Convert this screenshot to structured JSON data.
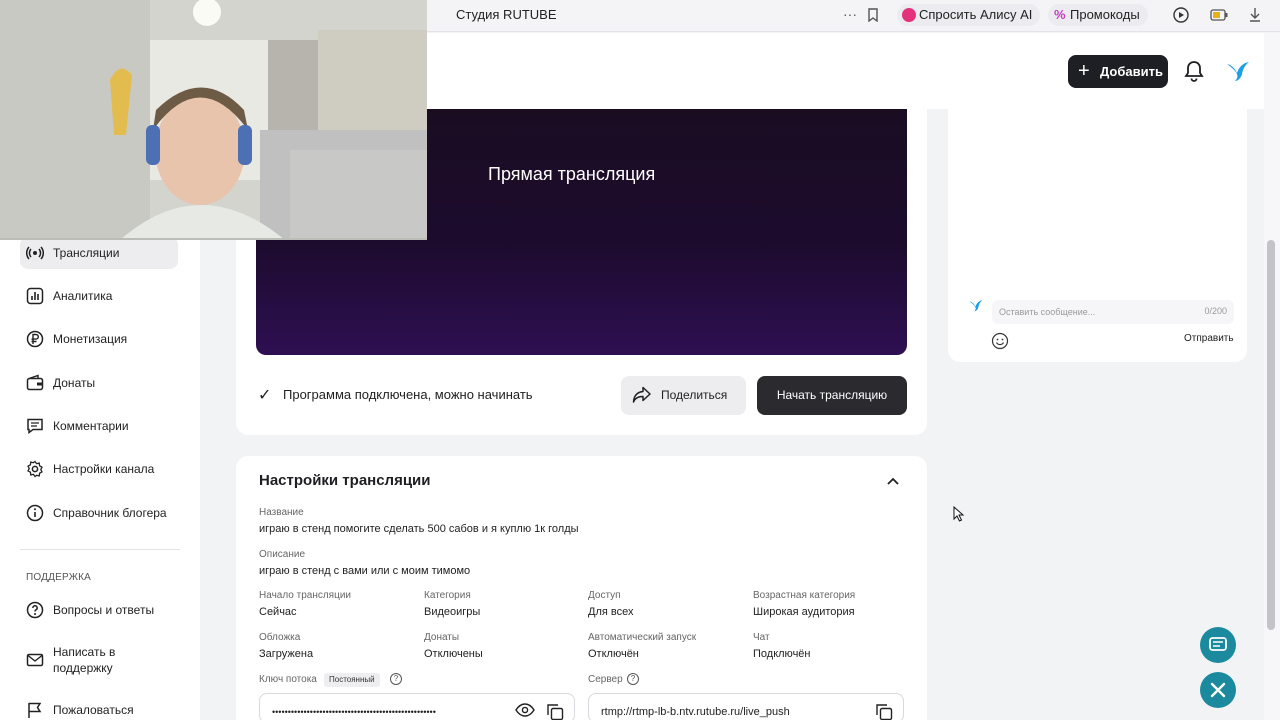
{
  "browser": {
    "tab_title": "Студия RUTUBE",
    "ask_alice": "Спросить Алису AI",
    "promocodes": "Промокоды",
    "more_glyph": "···"
  },
  "header": {
    "add_label": "Добавить"
  },
  "sidebar": {
    "items": [
      {
        "label": "Трансляции",
        "icon": "broadcast-icon",
        "active": true
      },
      {
        "label": "Аналитика",
        "icon": "analytics-icon"
      },
      {
        "label": "Монетизация",
        "icon": "ruble-icon"
      },
      {
        "label": "Донаты",
        "icon": "wallet-icon"
      },
      {
        "label": "Комментарии",
        "icon": "comment-icon"
      },
      {
        "label": "Настройки канала",
        "icon": "gear-icon"
      },
      {
        "label": "Справочник блогера",
        "icon": "info-icon"
      }
    ],
    "support_section": "ПОДДЕРЖКА",
    "support_items": [
      {
        "label": "Вопросы и ответы",
        "icon": "question-icon"
      },
      {
        "label": "Написать в поддержку",
        "icon": "mail-icon"
      },
      {
        "label": "Пожаловаться",
        "icon": "flag-icon"
      }
    ]
  },
  "player": {
    "title": "Прямая трансляция"
  },
  "status": {
    "text": "Программа подключена, можно начинать",
    "share_label": "Поделиться",
    "start_label": "Начать трансляцию"
  },
  "settings": {
    "title": "Настройки трансляции",
    "name_label": "Название",
    "name_value": "играю в стенд помогите сделать 500 сабов и я куплю 1к голды",
    "description_label": "Описание",
    "description_value": "играю в стенд с вами или с моим тимомо",
    "fields": [
      {
        "label": "Начало трансляции",
        "value": "Сейчас"
      },
      {
        "label": "Категория",
        "value": "Видеоигры"
      },
      {
        "label": "Доступ",
        "value": "Для всех"
      },
      {
        "label": "Возрастная категория",
        "value": "Широкая аудитория"
      },
      {
        "label": "Обложка",
        "value": "Загружена"
      },
      {
        "label": "Донаты",
        "value": "Отключены"
      },
      {
        "label": "Автоматический запуск",
        "value": "Отключён"
      },
      {
        "label": "Чат",
        "value": "Подключён"
      }
    ],
    "stream_key_label": "Ключ потока",
    "stream_key_badge": "Постоянный",
    "stream_key_value": "••••••••••••••••••••••••••••••••••••••••••••••••••••",
    "server_label": "Сервер",
    "server_value": "rtmp://rtmp-lb-b.ntv.rutube.ru/live_push"
  },
  "chat": {
    "placeholder": "Оставить сообщение...",
    "counter": "0/200",
    "send_label": "Отправить"
  },
  "colors": {
    "accent_dark": "#1e1f24",
    "fab": "#1c8a9e",
    "brand_bird": "#1aa0e6"
  }
}
